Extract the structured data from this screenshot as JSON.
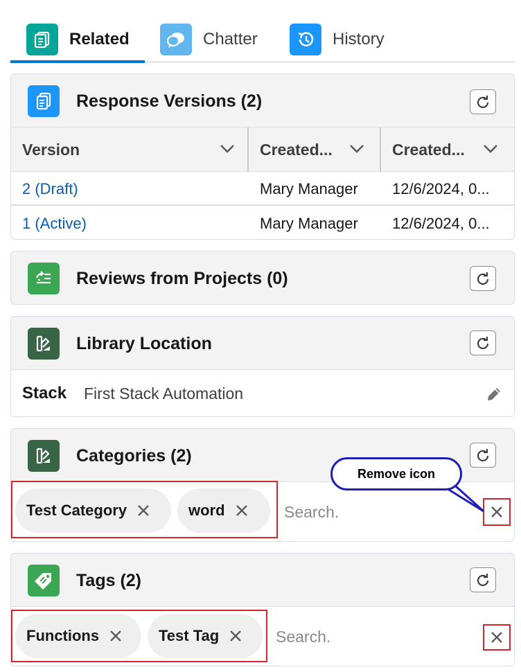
{
  "tabs": [
    {
      "label": "Related",
      "icon": "related-list-icon",
      "color": "#06a59a"
    },
    {
      "label": "Chatter",
      "icon": "chatter-icon",
      "color": "#62b6f0"
    },
    {
      "label": "History",
      "icon": "history-icon",
      "color": "#1b96ff"
    }
  ],
  "response_versions": {
    "title": "Response Versions (2)",
    "columns": [
      "Version",
      "Created...",
      "Created..."
    ],
    "rows": [
      {
        "version": "2 (Draft)",
        "created_by": "Mary Manager",
        "created_date": "12/6/2024, 0..."
      },
      {
        "version": "1 (Active)",
        "created_by": "Mary Manager",
        "created_date": "12/6/2024, 0..."
      }
    ]
  },
  "reviews": {
    "title": "Reviews from Projects (0)"
  },
  "library_location": {
    "title": "Library Location",
    "field_label": "Stack",
    "field_value": "First Stack Automation"
  },
  "categories": {
    "title": "Categories (2)",
    "chips": [
      "Test Category",
      "word"
    ],
    "search_placeholder": "Search."
  },
  "tags": {
    "title": "Tags (2)",
    "chips": [
      "Functions",
      "Test Tag"
    ],
    "search_placeholder": "Search."
  },
  "annotation": {
    "text": "Remove icon"
  },
  "colors": {
    "accent": "#0176d3",
    "link": "#0b5cab",
    "highlight_box": "#d0272e",
    "callout_border": "#1f1fb4",
    "response_icon": "#1b96ff",
    "reviews_icon": "#3ba755",
    "library_icon": "#396547",
    "tags_icon": "#3ba755"
  }
}
